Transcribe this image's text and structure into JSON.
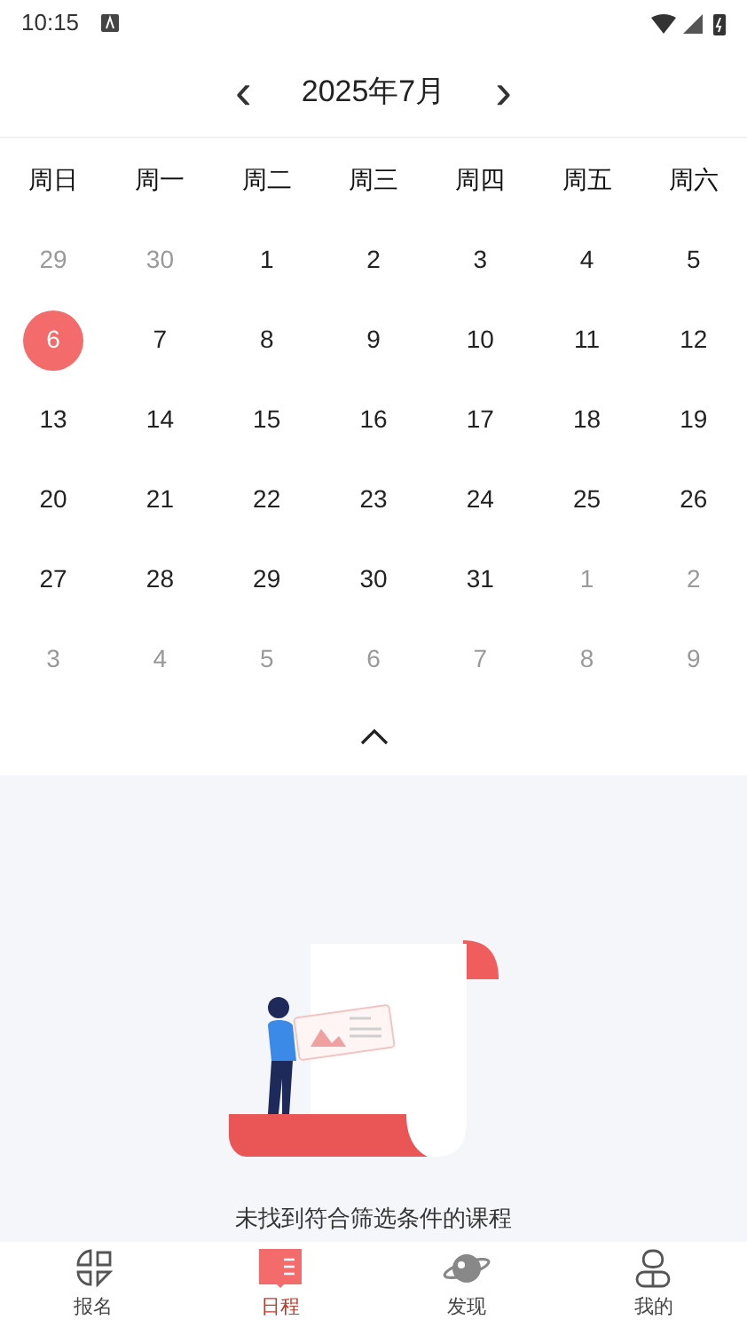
{
  "status_bar": {
    "time": "10:15"
  },
  "header": {
    "prev": "‹",
    "title": "2025年7月",
    "next": "›"
  },
  "weekdays": [
    "周日",
    "周一",
    "周二",
    "周三",
    "周四",
    "周五",
    "周六"
  ],
  "days": [
    {
      "label": "29",
      "muted": true,
      "selected": false
    },
    {
      "label": "30",
      "muted": true,
      "selected": false
    },
    {
      "label": "1",
      "muted": false,
      "selected": false
    },
    {
      "label": "2",
      "muted": false,
      "selected": false
    },
    {
      "label": "3",
      "muted": false,
      "selected": false
    },
    {
      "label": "4",
      "muted": false,
      "selected": false
    },
    {
      "label": "5",
      "muted": false,
      "selected": false
    },
    {
      "label": "6",
      "muted": false,
      "selected": true
    },
    {
      "label": "7",
      "muted": false,
      "selected": false
    },
    {
      "label": "8",
      "muted": false,
      "selected": false
    },
    {
      "label": "9",
      "muted": false,
      "selected": false
    },
    {
      "label": "10",
      "muted": false,
      "selected": false
    },
    {
      "label": "11",
      "muted": false,
      "selected": false
    },
    {
      "label": "12",
      "muted": false,
      "selected": false
    },
    {
      "label": "13",
      "muted": false,
      "selected": false
    },
    {
      "label": "14",
      "muted": false,
      "selected": false
    },
    {
      "label": "15",
      "muted": false,
      "selected": false
    },
    {
      "label": "16",
      "muted": false,
      "selected": false
    },
    {
      "label": "17",
      "muted": false,
      "selected": false
    },
    {
      "label": "18",
      "muted": false,
      "selected": false
    },
    {
      "label": "19",
      "muted": false,
      "selected": false
    },
    {
      "label": "20",
      "muted": false,
      "selected": false
    },
    {
      "label": "21",
      "muted": false,
      "selected": false
    },
    {
      "label": "22",
      "muted": false,
      "selected": false
    },
    {
      "label": "23",
      "muted": false,
      "selected": false
    },
    {
      "label": "24",
      "muted": false,
      "selected": false
    },
    {
      "label": "25",
      "muted": false,
      "selected": false
    },
    {
      "label": "26",
      "muted": false,
      "selected": false
    },
    {
      "label": "27",
      "muted": false,
      "selected": false
    },
    {
      "label": "28",
      "muted": false,
      "selected": false
    },
    {
      "label": "29",
      "muted": false,
      "selected": false
    },
    {
      "label": "30",
      "muted": false,
      "selected": false
    },
    {
      "label": "31",
      "muted": false,
      "selected": false
    },
    {
      "label": "1",
      "muted": true,
      "selected": false
    },
    {
      "label": "2",
      "muted": true,
      "selected": false
    },
    {
      "label": "3",
      "muted": true,
      "selected": false
    },
    {
      "label": "4",
      "muted": true,
      "selected": false
    },
    {
      "label": "5",
      "muted": true,
      "selected": false
    },
    {
      "label": "6",
      "muted": true,
      "selected": false
    },
    {
      "label": "7",
      "muted": true,
      "selected": false
    },
    {
      "label": "8",
      "muted": true,
      "selected": false
    },
    {
      "label": "9",
      "muted": true,
      "selected": false
    }
  ],
  "calendar_toggle": {
    "expanded": true
  },
  "empty_state": {
    "message": "未找到符合筛选条件的课程"
  },
  "tab_bar": [
    {
      "kind": "grid",
      "label": "报名",
      "selected": false
    },
    {
      "kind": "book",
      "label": "日程",
      "selected": true
    },
    {
      "kind": "planet",
      "label": "发现",
      "selected": false
    },
    {
      "kind": "person",
      "label": "我的",
      "selected": false
    }
  ]
}
